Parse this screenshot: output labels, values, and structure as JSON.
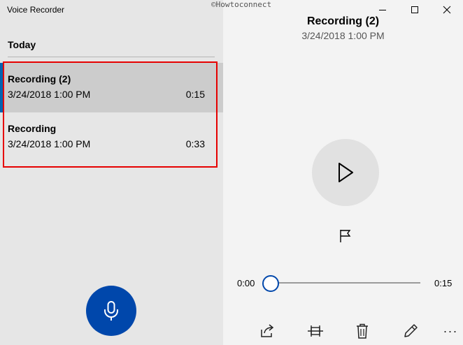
{
  "app": {
    "title": "Voice Recorder",
    "watermark": "©Howtoconnect"
  },
  "list": {
    "section_header": "Today",
    "items": [
      {
        "name": "Recording (2)",
        "date": "3/24/2018 1:00 PM",
        "duration": "0:15",
        "selected": true
      },
      {
        "name": "Recording",
        "date": "3/24/2018 1:00 PM",
        "duration": "0:33",
        "selected": false
      }
    ]
  },
  "player": {
    "title": "Recording (2)",
    "date": "3/24/2018 1:00 PM",
    "time_start": "0:00",
    "time_end": "0:15",
    "progress": 0.0
  },
  "toolbar": {
    "more_label": "···"
  },
  "icons": {
    "mic": "microphone-icon",
    "play": "play-icon",
    "flag": "flag-icon",
    "share": "share-icon",
    "trim": "trim-icon",
    "delete": "trash-icon",
    "rename": "pencil-icon"
  },
  "colors": {
    "accent": "#0047ab",
    "selection_bar": "#0063b1",
    "highlight": "#e60000"
  }
}
